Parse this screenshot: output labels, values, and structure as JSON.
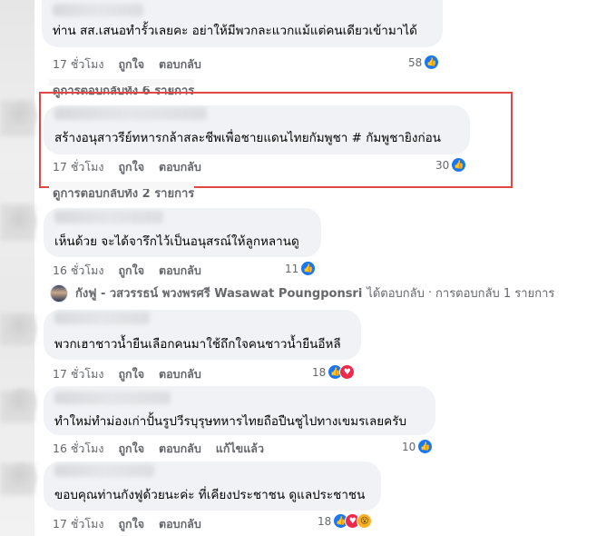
{
  "comments": [
    {
      "text": "ท่าน สส.เสนอทำรั้วเลยคะ อย่าให้มีพวกละแวกแม้แต่คนเดียวเข้ามาได้",
      "time": "17 ชั่วโมง",
      "like_label": "ถูกใจ",
      "reply_label": "ตอบกลับ",
      "reaction_count": "58",
      "reactions": [
        "like-icon"
      ]
    },
    {
      "text": "สร้างอนุสาวรีย์ทหารกล้าสละชีพเพื่อชายแดนไทยกัมพูชา # กัมพูชายิงก่อน",
      "time": "17 ชั่วโมง",
      "like_label": "ถูกใจ",
      "reply_label": "ตอบกลับ",
      "reaction_count": "30",
      "reactions": [
        "like-icon"
      ]
    },
    {
      "text": "เห็นด้วย จะได้จารึกไว้เป็นอนุสรณ์ให้ลูกหลานดู",
      "time": "16 ชั่วโมง",
      "like_label": "ถูกใจ",
      "reply_label": "ตอบกลับ",
      "reaction_count": "11",
      "reactions": [
        "like-icon"
      ]
    },
    {
      "text": "พวกเฮาชาวน้ำยืนเลือกคนมาใช้ถึกใจคนชาวน้ำยืนอีหลี",
      "time": "17 ชั่วโมง",
      "like_label": "ถูกใจ",
      "reply_label": "ตอบกลับ",
      "reaction_count": "18",
      "reactions": [
        "like-icon",
        "love-icon"
      ]
    },
    {
      "text": "ทำใหม่ทำม่องเก่าปั้นรูปวีรบุรุษทหารไทยถือปืนชูไปทางเขมรเลยครับ",
      "time": "16 ชั่วโมง",
      "like_label": "ถูกใจ",
      "reply_label": "ตอบกลับ",
      "edited_label": "แก้ไขแล้ว",
      "reaction_count": "10",
      "reactions": [
        "like-icon"
      ]
    },
    {
      "text": "ขอบคุณท่านกังฟูด้วยนะค่ะ ที่เคียงประชาชน ดูแลประชาชน",
      "time": "17 ชั่วโมง",
      "like_label": "ถูกใจ",
      "reply_label": "ตอบกลับ",
      "reaction_count": "18",
      "reactions": [
        "like-icon",
        "love-icon",
        "wow-icon"
      ]
    }
  ],
  "view_replies": [
    "ดูการตอบกลับทั้ง 6 รายการ",
    "ดูการตอบกลับทั้ง 2 รายการ"
  ],
  "reply_notice": {
    "replier": "กังฟู - วสวรรธน์ พวงพรศรี Wasawat Poungponsri",
    "action": "ได้ตอบกลับ",
    "separator": "·",
    "count_text": "การตอบกลับ 1 รายการ"
  },
  "colors": {
    "bubble": "#f0f2f5",
    "meta_text": "#65676b",
    "like_blue": "#1877f2",
    "love_red": "#f0284a",
    "wow_yellow": "#f7b125",
    "highlight_border": "#e04848"
  }
}
